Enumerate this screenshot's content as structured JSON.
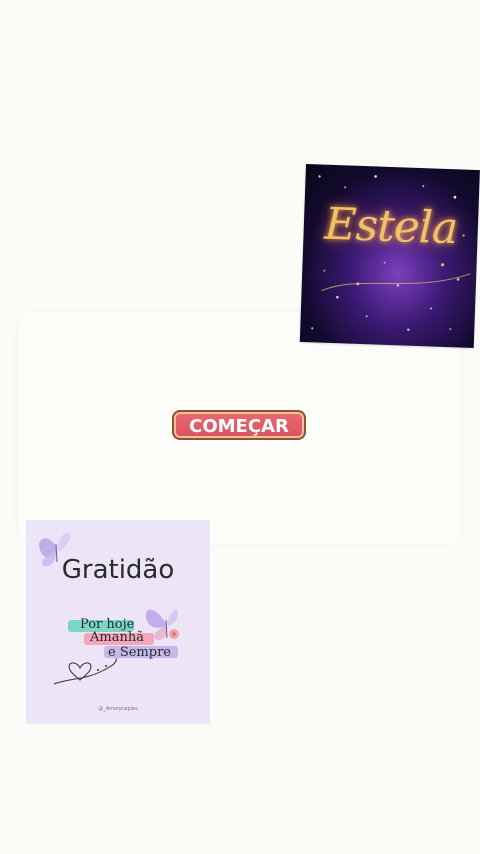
{
  "cards": {
    "estela": {
      "title": "Estela"
    },
    "gratidao": {
      "title": "Gratidão",
      "line_1": "Por hoje",
      "line_2": "Amanhã",
      "line_3": "e Sempre",
      "credit": "@_Amorprapies"
    }
  },
  "actions": {
    "start_label": "COMEÇAR"
  },
  "icons": {
    "butterfly": "butterfly-icon",
    "heart": "heart-icon",
    "sparkles": "sparkles-icon"
  },
  "colors": {
    "background": "#fbfbf7",
    "button": "#e0616b",
    "estela_gold": "#f0c06a",
    "card_lavender": "#ece4f7"
  }
}
